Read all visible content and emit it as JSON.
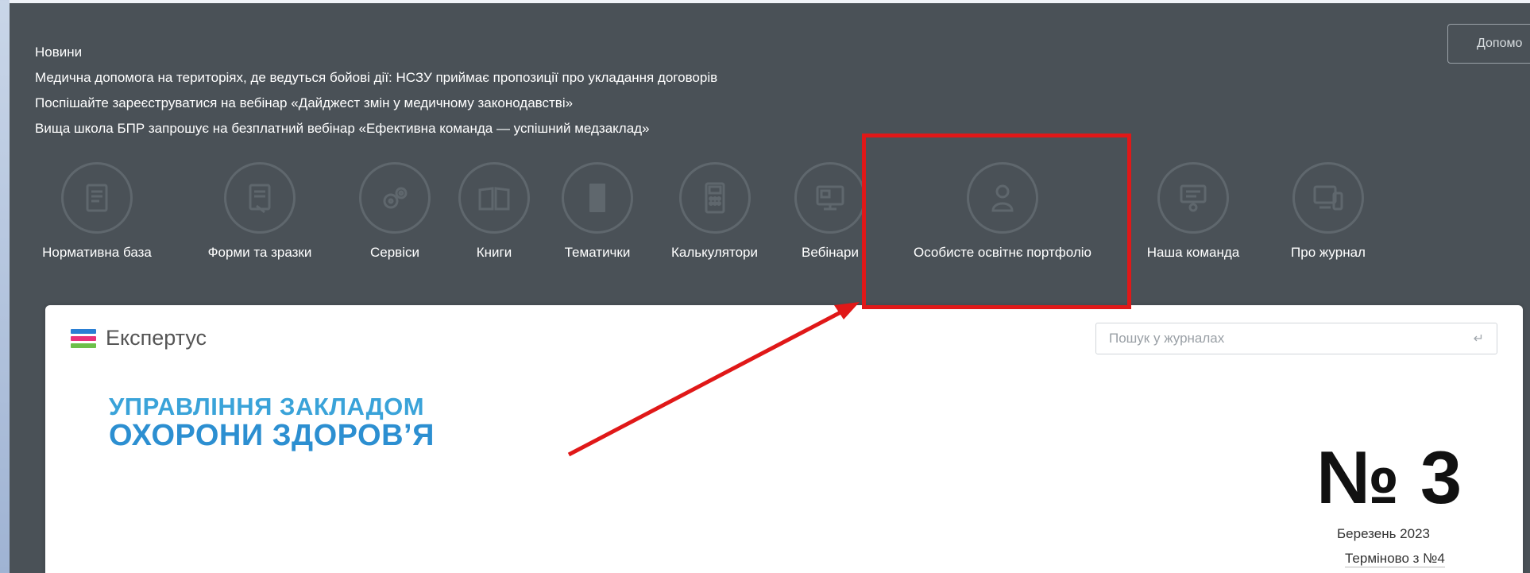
{
  "news": {
    "header": "Новини",
    "items": [
      "Медична допомога на територіях, де ведуться бойові дії: НСЗУ приймає пропозиції про укладання договорів",
      "Поспішайте зареєструватися на вебінар «Дайджест змін у медичному законодавстві»",
      "Вища школа БПР запрошує на безплатний вебінар «Ефективна команда — успішний медзаклад»"
    ]
  },
  "help_button": "Допомо",
  "nav": [
    {
      "label": "Нормативна база",
      "icon": "document-icon"
    },
    {
      "label": "Форми та зразки",
      "icon": "form-icon"
    },
    {
      "label": "Сервіси",
      "icon": "gears-icon"
    },
    {
      "label": "Книги",
      "icon": "book-icon"
    },
    {
      "label": "Тематички",
      "icon": "booklet-icon"
    },
    {
      "label": "Калькулятори",
      "icon": "calculator-icon"
    },
    {
      "label": "Вебінари",
      "icon": "monitor-icon"
    },
    {
      "label": "Особисте освітнє портфоліо",
      "icon": "user-icon"
    },
    {
      "label": "Наша команда",
      "icon": "presentation-icon"
    },
    {
      "label": "Про журнал",
      "icon": "devices-icon"
    }
  ],
  "card": {
    "brand": "Експертус",
    "search_placeholder": "Пошук у журналах",
    "title_line1": "УПРАВЛІННЯ ЗАКЛАДОМ",
    "title_line2": "ОХОРОНИ ЗДОРОВ’Я",
    "issue_number": "№ 3",
    "issue_date": "Березень 2023",
    "issue_link": "Терміново з №4"
  },
  "colors": {
    "panel": "#4a5157",
    "highlight": "#e01818",
    "title_blue": "#2c8fd1",
    "logo_bars": [
      "#2a7fd4",
      "#e8327a",
      "#6cc04a"
    ]
  }
}
